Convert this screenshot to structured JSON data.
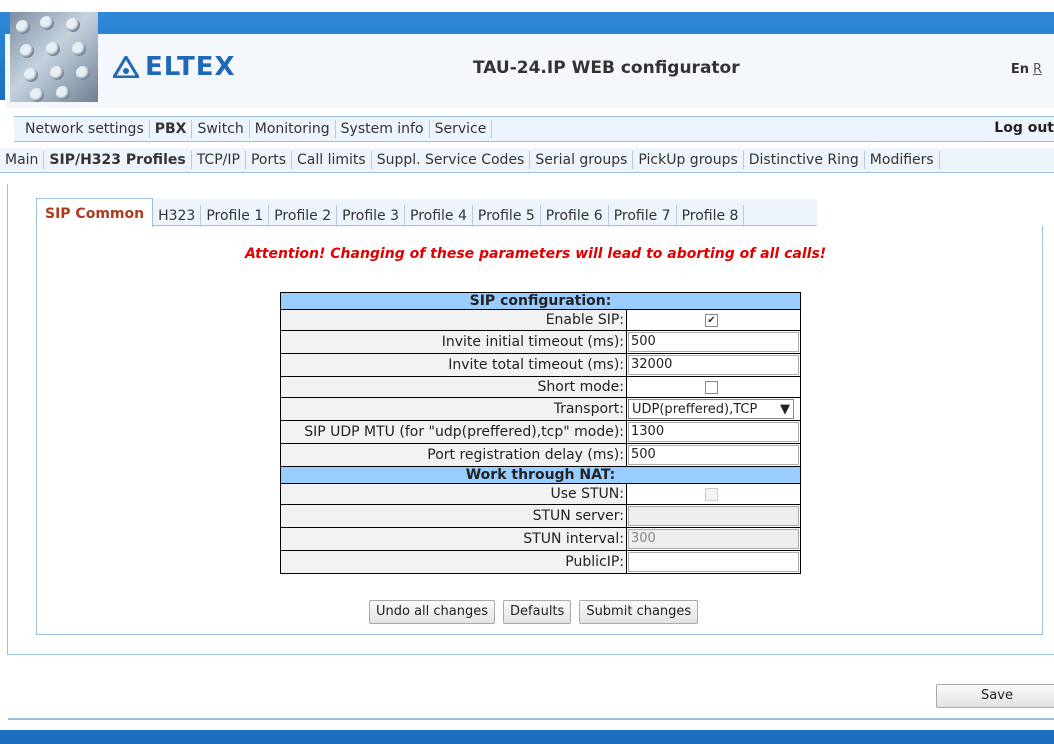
{
  "header": {
    "logo_text": "ELTEX",
    "title": "TAU-24.IP WEB configurator",
    "lang_en": "En",
    "lang_r": "R"
  },
  "menu1": {
    "items": [
      "Network settings",
      "PBX",
      "Switch",
      "Monitoring",
      "System info",
      "Service"
    ],
    "active": "PBX",
    "logout": "Log out"
  },
  "menu2": {
    "items": [
      "Main",
      "SIP/H323 Profiles",
      "TCP/IP",
      "Ports",
      "Call limits",
      "Suppl. Service Codes",
      "Serial groups",
      "PickUp groups",
      "Distinctive Ring",
      "Modifiers"
    ],
    "active": "SIP/H323 Profiles"
  },
  "tabs": {
    "items": [
      "SIP Common",
      "H323",
      "Profile 1",
      "Profile 2",
      "Profile 3",
      "Profile 4",
      "Profile 5",
      "Profile 6",
      "Profile 7",
      "Profile 8"
    ],
    "active": "SIP Common"
  },
  "attention": "Attention! Changing of these parameters will lead to aborting of all calls!",
  "sip": {
    "header": "SIP configuration:",
    "enable_sip_label": "Enable SIP:",
    "enable_sip": true,
    "invite_initial_label": "Invite initial timeout (ms):",
    "invite_initial": "500",
    "invite_total_label": "Invite total timeout (ms):",
    "invite_total": "32000",
    "short_mode_label": "Short mode:",
    "short_mode": false,
    "transport_label": "Transport:",
    "transport": "UDP(preffered),TCP",
    "mtu_label": "SIP UDP MTU (for \"udp(preffered),tcp\" mode):",
    "mtu": "1300",
    "port_reg_label": "Port registration delay (ms):",
    "port_reg": "500"
  },
  "nat": {
    "header": "Work through NAT:",
    "use_stun_label": "Use STUN:",
    "use_stun": false,
    "stun_server_label": "STUN server:",
    "stun_server": "",
    "stun_interval_label": "STUN interval:",
    "stun_interval": "300",
    "public_ip_label": "PublicIP:",
    "public_ip": ""
  },
  "buttons": {
    "undo": "Undo all changes",
    "defaults": "Defaults",
    "submit": "Submit changes",
    "save": "Save"
  }
}
